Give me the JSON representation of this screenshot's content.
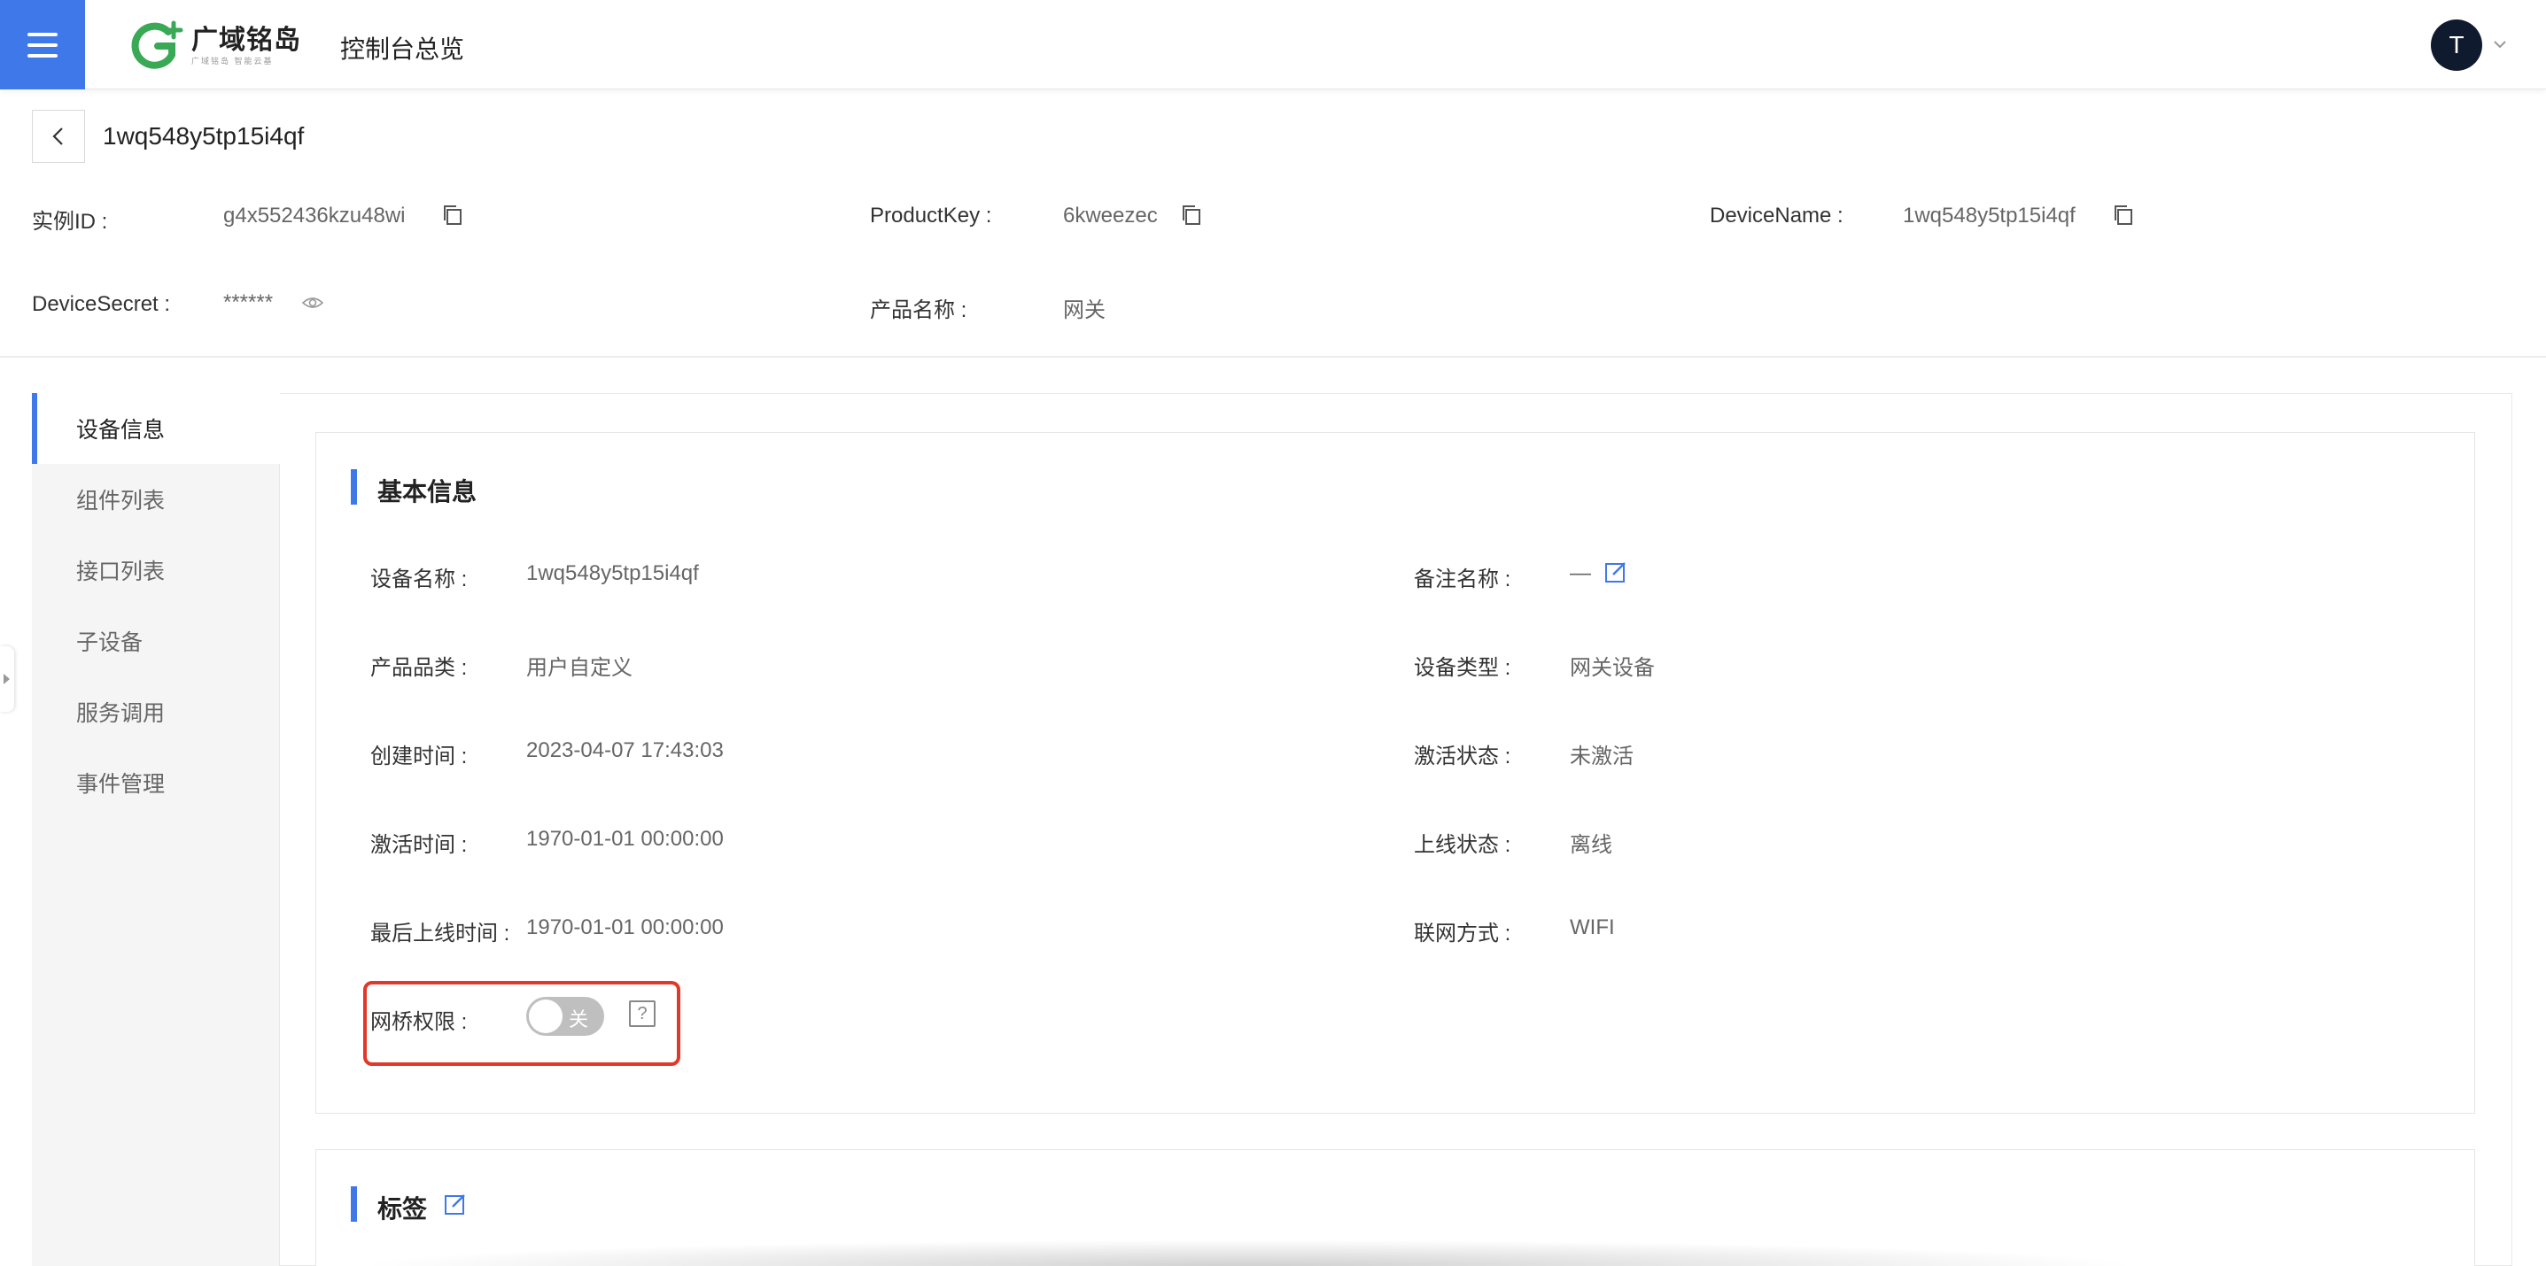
{
  "topbar": {
    "logo_text": "广域铭岛",
    "logo_sub": "广域铭岛 智能云基",
    "title": "控制台总览",
    "avatar_letter": "T"
  },
  "header": {
    "device_title": "1wq548y5tp15i4qf",
    "instance_id_label": "实例ID :",
    "instance_id": "g4x552436kzu48wi",
    "product_key_label": "ProductKey :",
    "product_key": "6kweezec",
    "device_name_label": "DeviceName :",
    "device_name": "1wq548y5tp15i4qf",
    "device_secret_label": "DeviceSecret :",
    "device_secret": "******",
    "product_name_label": "产品名称 :",
    "product_name": "网关"
  },
  "sidebar": {
    "items": [
      {
        "label": "设备信息"
      },
      {
        "label": "组件列表"
      },
      {
        "label": "接口列表"
      },
      {
        "label": "子设备"
      },
      {
        "label": "服务调用"
      },
      {
        "label": "事件管理"
      }
    ]
  },
  "basic_info": {
    "title": "基本信息",
    "fields_left": [
      {
        "label": "设备名称 :",
        "value": "1wq548y5tp15i4qf"
      },
      {
        "label": "产品品类 :",
        "value": "用户自定义"
      },
      {
        "label": "创建时间 :",
        "value": "2023-04-07 17:43:03"
      },
      {
        "label": "激活时间 :",
        "value": "1970-01-01 00:00:00"
      },
      {
        "label": "最后上线时间 :",
        "value": "1970-01-01 00:00:00"
      }
    ],
    "fields_right": [
      {
        "label": "备注名称 :",
        "value": "—"
      },
      {
        "label": "设备类型 :",
        "value": "网关设备"
      },
      {
        "label": "激活状态 :",
        "value": "未激活"
      },
      {
        "label": "上线状态 :",
        "value": "离线"
      },
      {
        "label": "联网方式 :",
        "value": "WIFI"
      }
    ],
    "bridge_label": "网桥权限 :",
    "bridge_switch_text": "关",
    "help_text": "?"
  },
  "tags": {
    "title": "标签"
  },
  "colors": {
    "accent": "#3f78e8",
    "highlight": "#e0382a",
    "logo_green": "#3aa956"
  }
}
